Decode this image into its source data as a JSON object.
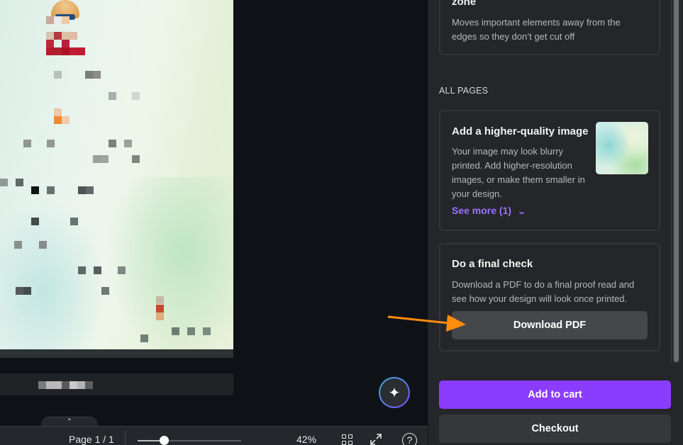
{
  "canvas": {
    "footer_text_blurred": true
  },
  "assistant_button": {
    "icon": "sparkle-icon",
    "glyph": "✦"
  },
  "bottom_bar": {
    "expand_tab_glyph": "⌃",
    "page_indicator": "Page 1 / 1",
    "zoom_percent": 42,
    "zoom_label": "42%",
    "grid_view_icon": "grid-icon",
    "fullscreen_icon": "expand-icon",
    "help_glyph": "?"
  },
  "panel": {
    "safe_zone_card": {
      "title_fragment": "zone",
      "description": "Moves important elements away from the edges so they don’t get cut off"
    },
    "section_label": "ALL PAGES",
    "image_quality_card": {
      "title": "Add a higher-quality image",
      "description": "Your image may look blurry printed. Add higher-resolution images, or make them smaller in your design.",
      "see_more_label": "See more (1)",
      "see_more_glyph": "⌄"
    },
    "final_check_card": {
      "title": "Do a final check",
      "description": "Download a PDF to do a final proof read and see how your design will look once printed.",
      "download_label": "Download PDF"
    },
    "add_to_cart_label": "Add to cart",
    "checkout_label": "Checkout"
  },
  "colors": {
    "accent_purple": "#8b3dff",
    "link_purple": "#9b73ff",
    "annotation_arrow": "#ff8c0a",
    "panel_bg": "#252629",
    "stage_bg": "#0e1217"
  }
}
